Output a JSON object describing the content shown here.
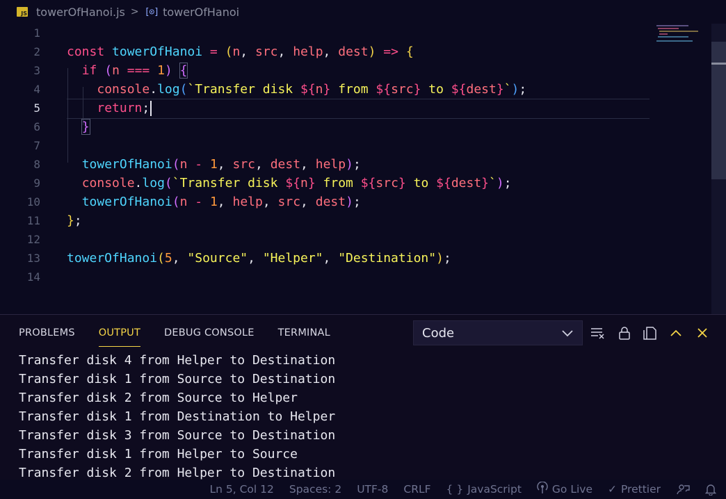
{
  "breadcrumb": {
    "file_icon": "js-file-icon",
    "file_icon_label": "JS",
    "file_name": "towerOfHanoi.js",
    "separator": ">",
    "symbol_icon": "symbol-variable-icon",
    "symbol_name": "towerOfHanoi"
  },
  "editor": {
    "line_numbers": [
      "1",
      "2",
      "3",
      "4",
      "5",
      "6",
      "7",
      "8",
      "9",
      "10",
      "11",
      "12",
      "13",
      "14"
    ],
    "active_line": "5"
  },
  "panel": {
    "tabs": [
      {
        "label": "PROBLEMS"
      },
      {
        "label": "OUTPUT"
      },
      {
        "label": "DEBUG CONSOLE"
      },
      {
        "label": "TERMINAL"
      }
    ],
    "active_tab": "OUTPUT",
    "output_channel": "Code",
    "icons": [
      "chevron-down-icon",
      "clear-output-icon",
      "lock-icon",
      "open-in-editor-icon",
      "maximize-panel-icon",
      "close-panel-icon"
    ],
    "output_lines": [
      "Transfer disk 4 from Helper to Destination",
      "Transfer disk 1 from Source to Destination",
      "Transfer disk 2 from Source to Helper",
      "Transfer disk 1 from Destination to Helper",
      "Transfer disk 3 from Source to Destination",
      "Transfer disk 1 from Helper to Source",
      "Transfer disk 2 from Helper to Destination"
    ]
  },
  "status_bar": {
    "position": "Ln 5, Col 12",
    "spaces": "Spaces: 2",
    "encoding": "UTF-8",
    "eol": "CRLF",
    "language": "JavaScript",
    "language_icon": "{ }",
    "go_live": "Go Live",
    "prettier": "Prettier",
    "prettier_icon": "✓"
  },
  "colors": {
    "background": "#0b0a1f",
    "keyword": "#ff4f8b",
    "function": "#4fd6ff",
    "string": "#f7f35a",
    "number": "#ff9a3c",
    "active_tab": "#f5d547"
  }
}
